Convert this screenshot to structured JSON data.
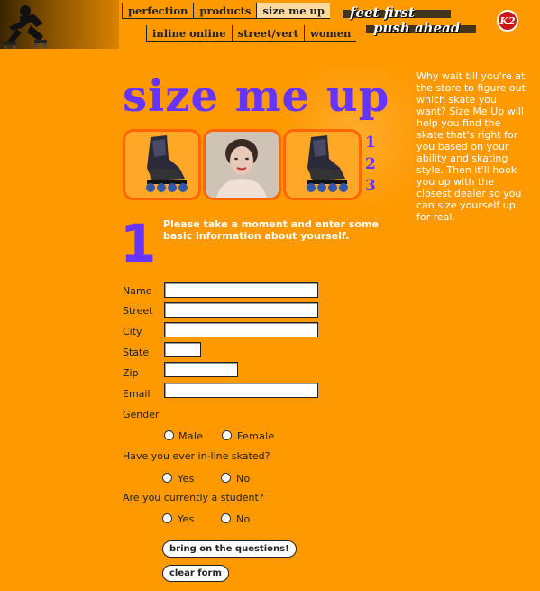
{
  "nav": {
    "top": [
      "perfection",
      "products",
      "size me up"
    ],
    "bottom": [
      "inline online",
      "street/vert",
      "women"
    ],
    "active": "size me up"
  },
  "tagline": {
    "line1": "feet first",
    "line2": "push ahead"
  },
  "brand": {
    "logo_text": "K2"
  },
  "title": "size me up",
  "steps": [
    "1",
    "2",
    "3"
  ],
  "step_number": "1",
  "intro": "Please take a moment and enter some basic information about yourself.",
  "sidebar": "Why wait till you're at the store to figure out which skate you want? Size Me Up will help you find the skate that's right for you based on your ability and skating style. Then it'll hook you up with the closest dealer so you can size yourself up for real.",
  "form": {
    "name_label": "Name",
    "street_label": "Street",
    "city_label": "City",
    "state_label": "State",
    "zip_label": "Zip",
    "email_label": "Email",
    "gender_label": "Gender",
    "gender_options": [
      "Male",
      "Female"
    ],
    "skated_label": "Have you ever in-line skated?",
    "skated_options": [
      "Yes",
      "No"
    ],
    "student_label": "Are you currently a student?",
    "student_options": [
      "Yes",
      "No"
    ]
  },
  "buttons": {
    "submit": "bring on the questions!",
    "clear": "clear form"
  },
  "colors": {
    "background": "#FF9900",
    "accent": "#6633FF",
    "frame": "#FF6600"
  }
}
